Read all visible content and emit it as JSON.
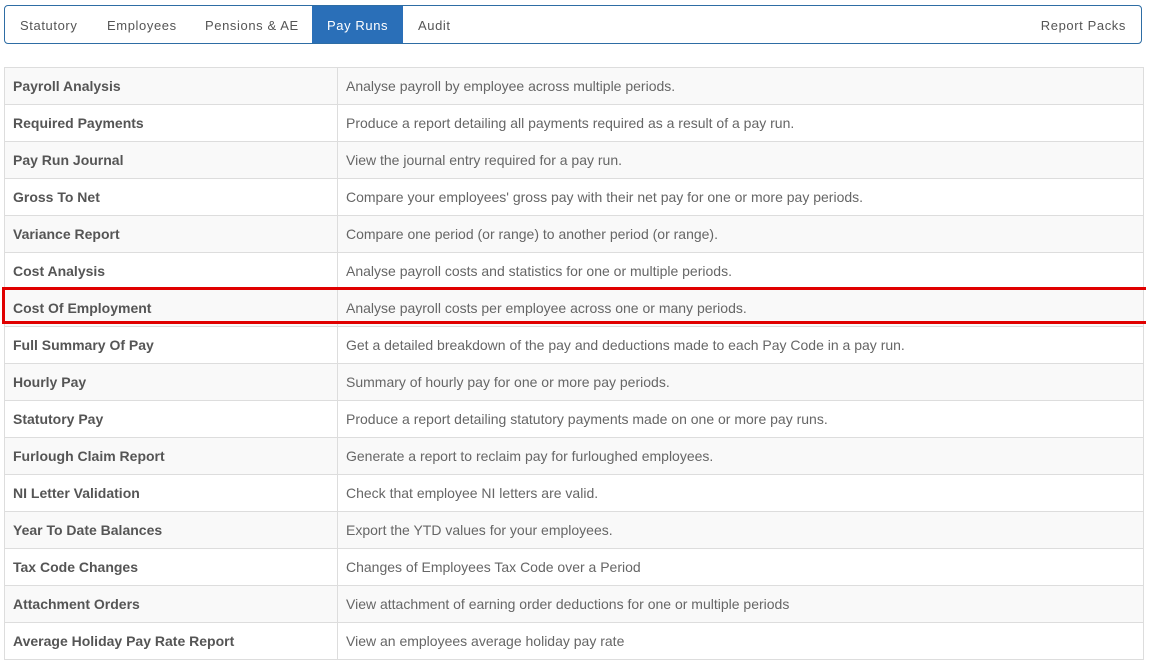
{
  "tabs": [
    {
      "label": "Statutory"
    },
    {
      "label": "Employees"
    },
    {
      "label": "Pensions & AE"
    },
    {
      "label": "Pay Runs"
    },
    {
      "label": "Audit"
    }
  ],
  "active_tab": "Pay Runs",
  "report_packs_label": "Report Packs",
  "highlight_color": "#e00000",
  "accent_color": "#2a6fb8",
  "reports": [
    {
      "name": "Payroll Analysis",
      "description": "Analyse payroll by employee across multiple periods."
    },
    {
      "name": "Required Payments",
      "description": "Produce a report detailing all payments required as a result of a pay run."
    },
    {
      "name": "Pay Run Journal",
      "description": "View the journal entry required for a pay run."
    },
    {
      "name": "Gross To Net",
      "description": "Compare your employees' gross pay with their net pay for one or more pay periods."
    },
    {
      "name": "Variance Report",
      "description": "Compare one period (or range) to another period (or range)."
    },
    {
      "name": "Cost Analysis",
      "description": "Analyse payroll costs and statistics for one or multiple periods."
    },
    {
      "name": "Cost Of Employment",
      "description": "Analyse payroll costs per employee across one or many periods."
    },
    {
      "name": "Full Summary Of Pay",
      "description": "Get a detailed breakdown of the pay and deductions made to each Pay Code in a pay run."
    },
    {
      "name": "Hourly Pay",
      "description": "Summary of hourly pay for one or more pay periods."
    },
    {
      "name": "Statutory Pay",
      "description": "Produce a report detailing statutory payments made on one or more pay runs."
    },
    {
      "name": "Furlough Claim Report",
      "description": "Generate a report to reclaim pay for furloughed employees."
    },
    {
      "name": "NI Letter Validation",
      "description": "Check that employee NI letters are valid."
    },
    {
      "name": "Year To Date Balances",
      "description": "Export the YTD values for your employees."
    },
    {
      "name": "Tax Code Changes",
      "description": "Changes of Employees Tax Code over a Period"
    },
    {
      "name": "Attachment Orders",
      "description": "View attachment of earning order deductions for one or multiple periods"
    },
    {
      "name": "Average Holiday Pay Rate Report",
      "description": "View an employees average holiday pay rate"
    }
  ]
}
